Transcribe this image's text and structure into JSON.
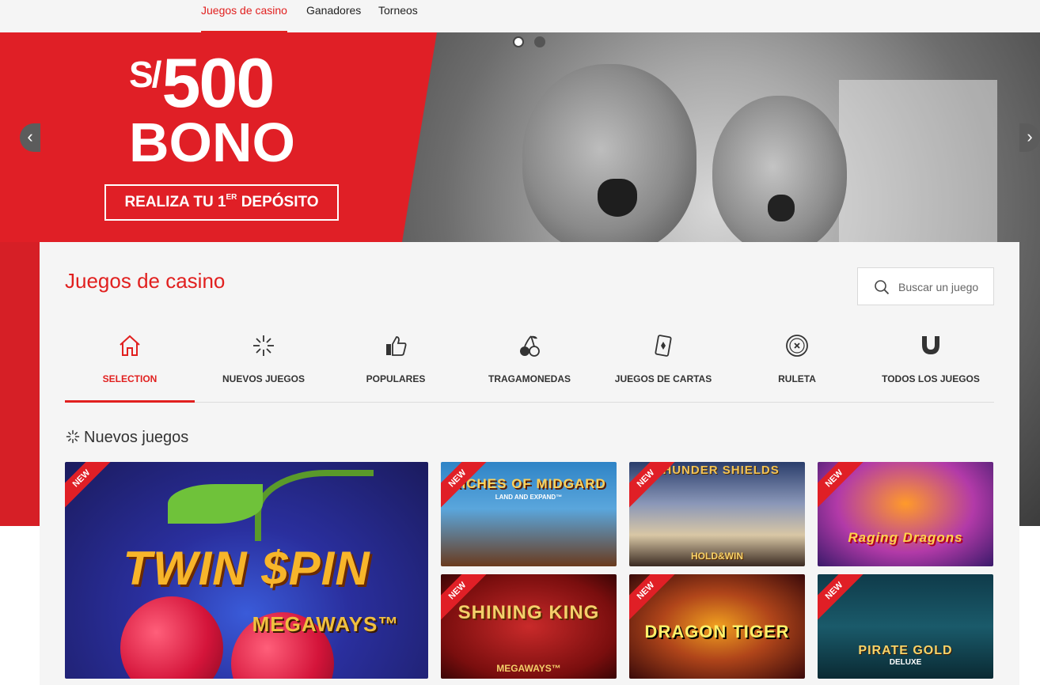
{
  "topnav": {
    "tabs": [
      {
        "label": "Juegos de casino",
        "active": true
      },
      {
        "label": "Ganadores",
        "active": false
      },
      {
        "label": "Torneos",
        "active": false
      }
    ]
  },
  "hero": {
    "currency": "S/",
    "amount": "500",
    "word": "BONO",
    "cta_main": "REALIZA TU 1",
    "cta_sup": "ER",
    "cta_end": " DEPÓSITO",
    "slides": 2,
    "active_slide": 1
  },
  "panel": {
    "title": "Juegos de casino",
    "search_placeholder": "Buscar un juego"
  },
  "categories": [
    {
      "label": "SELECTION",
      "icon": "home-icon",
      "active": true
    },
    {
      "label": "NUEVOS JUEGOS",
      "icon": "sparkle-icon",
      "active": false
    },
    {
      "label": "POPULARES",
      "icon": "thumbs-up-icon",
      "active": false
    },
    {
      "label": "TRAGAMONEDAS",
      "icon": "cherries-icon",
      "active": false
    },
    {
      "label": "JUEGOS DE CARTAS",
      "icon": "cards-icon",
      "active": false
    },
    {
      "label": "RULETA",
      "icon": "roulette-icon",
      "active": false
    },
    {
      "label": "TODOS LOS JUEGOS",
      "icon": "magnet-icon",
      "active": false
    }
  ],
  "section": {
    "title": "Nuevos juegos"
  },
  "games": [
    {
      "title": "TWIN $PIN",
      "subtitle": "MEGAWAYS™",
      "badge": "NEW"
    },
    {
      "title": "RICHES OF MIDGARD",
      "subtitle": "LAND AND EXPAND™",
      "badge": "NEW"
    },
    {
      "title": "THUNDER SHIELDS",
      "subtitle": "HOLD&WIN",
      "badge": "NEW"
    },
    {
      "title": "Raging Dragons",
      "subtitle": "",
      "badge": "NEW"
    },
    {
      "title": "SHINING KING",
      "subtitle": "MEGAWAYS™",
      "badge": "NEW"
    },
    {
      "title": "DRAGON TIGER",
      "subtitle": "",
      "badge": "NEW"
    },
    {
      "title": "PIRATE GOLD",
      "subtitle": "DELUXE",
      "badge": "NEW"
    }
  ],
  "colors": {
    "brand_red": "#e1201f",
    "panel_bg": "#f5f5f5"
  }
}
